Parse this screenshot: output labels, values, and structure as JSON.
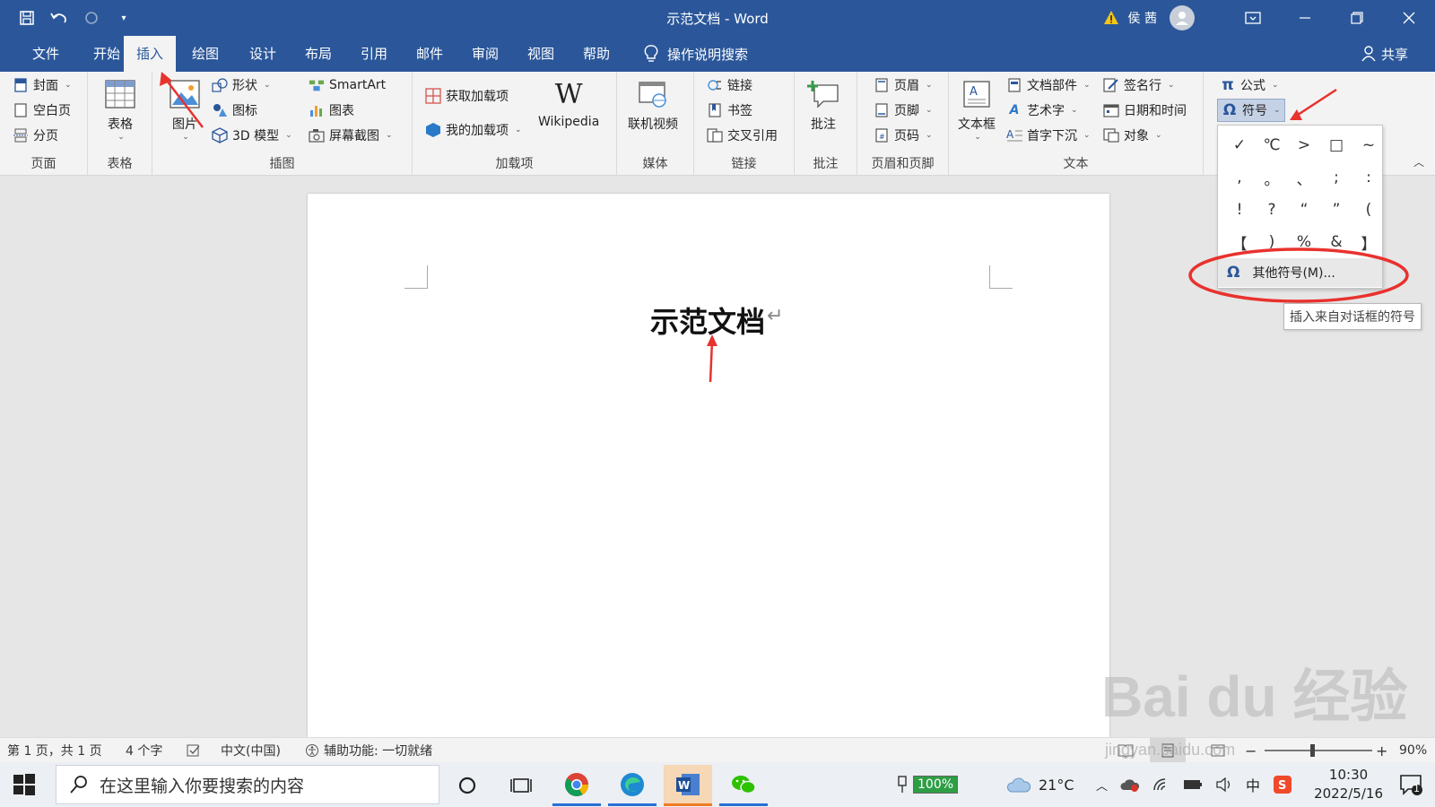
{
  "window": {
    "title": "示范文档 - Word",
    "user": "侯 茜"
  },
  "tabs": [
    {
      "label": "文件"
    },
    {
      "label": "开始"
    },
    {
      "label": "插入"
    },
    {
      "label": "绘图"
    },
    {
      "label": "设计"
    },
    {
      "label": "布局"
    },
    {
      "label": "引用"
    },
    {
      "label": "邮件"
    },
    {
      "label": "审阅"
    },
    {
      "label": "视图"
    },
    {
      "label": "帮助"
    }
  ],
  "tell_me": "操作说明搜索",
  "share": "共享",
  "ribbon": {
    "pages": {
      "label": "页面",
      "cover": "封面",
      "blank": "空白页",
      "break": "分页"
    },
    "table": {
      "label": "表格",
      "table": "表格"
    },
    "illustrations": {
      "label": "插图",
      "picture": "图片",
      "shapes": "形状",
      "icons": "图标",
      "model3d": "3D 模型",
      "smartart": "SmartArt",
      "chart": "图表",
      "screenshot": "屏幕截图"
    },
    "addins": {
      "label": "加载项",
      "get": "获取加载项",
      "my": "我的加载项",
      "wikipedia": "Wikipedia"
    },
    "media": {
      "label": "媒体",
      "video": "联机视频"
    },
    "links": {
      "label": "链接",
      "link": "链接",
      "bookmark": "书签",
      "crossref": "交叉引用"
    },
    "comments": {
      "label": "批注",
      "comment": "批注"
    },
    "header_footer": {
      "label": "页眉和页脚",
      "header": "页眉",
      "footer": "页脚",
      "page_number": "页码"
    },
    "text": {
      "label": "文本",
      "textbox": "文本框",
      "quickparts": "文档部件",
      "wordart": "艺术字",
      "dropcap": "首字下沉",
      "signature": "签名行",
      "datetime": "日期和时间",
      "object": "对象"
    },
    "symbols": {
      "equation": "公式",
      "symbol": "符号"
    }
  },
  "symbol_menu": {
    "symbols": [
      "✓",
      "℃",
      ">",
      "□",
      "~",
      ",",
      "。",
      "、",
      ";",
      ":",
      "!",
      "?",
      "“",
      "”",
      "(",
      "【",
      ")",
      "%",
      "&",
      "】"
    ],
    "more": "其他符号(M)...",
    "tooltip": "插入来自对话框的符号"
  },
  "document": {
    "title": "示范文档"
  },
  "status": {
    "page": "第 1 页，共 1 页",
    "words": "4 个字",
    "language": "中文(中国)",
    "accessibility": "辅助功能: 一切就绪",
    "zoom": "90%",
    "zoom_level": 0.9
  },
  "taskbar": {
    "search_placeholder": "在这里输入你要搜索的内容",
    "battery": "100%",
    "weather": "21°C",
    "ime": "中",
    "time": "10:30",
    "date": "2022/5/16",
    "notifications": "1"
  },
  "watermark": {
    "main": "Bai du 经验",
    "sub": "jingyan.baidu.com"
  },
  "colors": {
    "brand": "#2b579a",
    "annotation": "#e8322e"
  }
}
